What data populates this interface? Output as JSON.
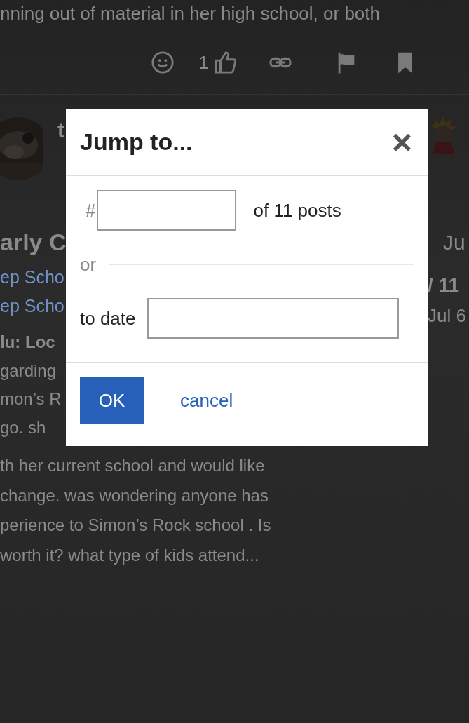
{
  "post_excerpt": "nning out of material in her high school, or both",
  "post_actions": {
    "like_count": "1"
  },
  "behind_left": {
    "username": "t",
    "title": "arly C",
    "categories": [
      "ep Scho",
      "ep Scho"
    ],
    "excerpt_lines": [
      {
        "text": "lu: Loc",
        "bold": true
      },
      {
        "text": "garding",
        "bold": false
      },
      {
        "text": "mon’s R",
        "bold": false
      },
      {
        "text": "go. sh",
        "bold": false
      }
    ]
  },
  "behind_right": {
    "date": "Ju",
    "progress": "/ 11",
    "progress_date": "Jul 6"
  },
  "excerpt_continued": [
    "th her current school and would like",
    "change. was wondering anyone has",
    "perience to Simon’s Rock school . Is",
    "worth it? what type of kids attend..."
  ],
  "modal": {
    "title": "Jump to...",
    "close": "×",
    "number_prefix": "#",
    "of_posts": "of 11 posts",
    "or": "or",
    "date_label": "to date",
    "ok": "OK",
    "cancel": "cancel"
  }
}
